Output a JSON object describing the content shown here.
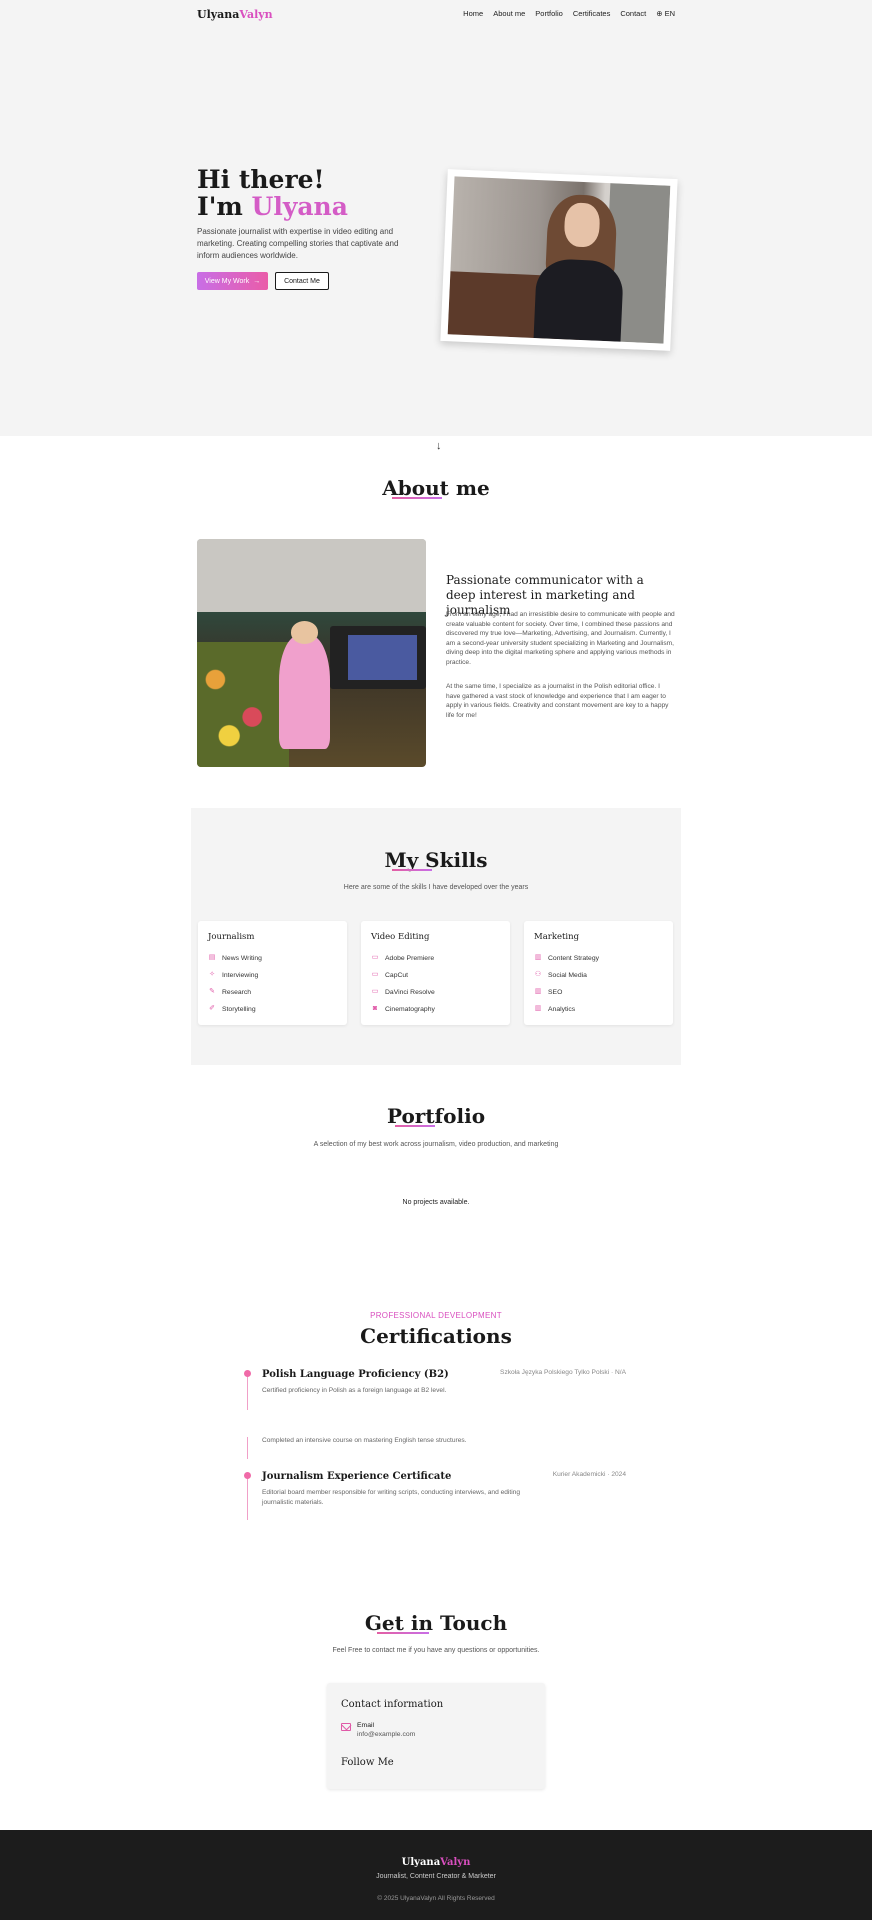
{
  "nav": {
    "logo_first": "Ulyana",
    "logo_second": "Valyn",
    "links": [
      "Home",
      "About me",
      "Portfolio",
      "Certificates",
      "Contact"
    ],
    "language": "EN",
    "language_icon": "globe-icon"
  },
  "hero": {
    "greeting": "Hi there!",
    "im": "I'm",
    "name": "Ulyana",
    "description": "Passionate journalist with expertise in video editing and marketing. Creating compelling stories that captivate and inform audiences worldwide.",
    "primary_button": "View My Work",
    "primary_button_icon": "arrow-right-icon",
    "secondary_button": "Contact Me",
    "scroll_icon": "arrow-down-icon"
  },
  "about": {
    "title": "About me",
    "heading": "Passionate communicator with a deep interest in marketing and journalism",
    "paragraph1": "From an early age, I had an irresistible desire to communicate with people and create valuable content for society. Over time, I combined these passions and discovered my true love—Marketing, Advertising, and Journalism. Currently, I am a second-year university student specializing in Marketing and Journalism, diving deep into the digital marketing sphere and applying various methods in practice.",
    "paragraph2": "At the same time, I specialize as a journalist in the Polish editorial office. I have gathered a vast stock of knowledge and experience that I am eager to apply in various fields. Creativity and constant movement are key to a happy life for me!"
  },
  "skills": {
    "title": "My Skills",
    "subtitle": "Here are some of the skills I have developed over the years",
    "categories": [
      {
        "name": "Journalism",
        "items": [
          {
            "label": "News Writing",
            "icon": "newspaper-icon"
          },
          {
            "label": "Interviewing",
            "icon": "sparkle-icon"
          },
          {
            "label": "Research",
            "icon": "pen-icon"
          },
          {
            "label": "Storytelling",
            "icon": "pencil-icon"
          }
        ]
      },
      {
        "name": "Video Editing",
        "items": [
          {
            "label": "Adobe Premiere",
            "icon": "video-icon"
          },
          {
            "label": "CapCut",
            "icon": "video-icon"
          },
          {
            "label": "DaVinci Resolve",
            "icon": "video-icon"
          },
          {
            "label": "Cinematography",
            "icon": "camera-icon"
          }
        ]
      },
      {
        "name": "Marketing",
        "items": [
          {
            "label": "Content Strategy",
            "icon": "bar-chart-icon"
          },
          {
            "label": "Social Media",
            "icon": "users-icon"
          },
          {
            "label": "SEO",
            "icon": "bar-chart-icon"
          },
          {
            "label": "Analytics",
            "icon": "bar-chart-icon"
          }
        ]
      }
    ]
  },
  "portfolio": {
    "title": "Portfolio",
    "subtitle": "A selection of my best work across journalism, video production, and marketing",
    "empty": "No projects available."
  },
  "certifications": {
    "kicker": "PROFESSIONAL DEVELOPMENT",
    "title": "Certifications",
    "items": [
      {
        "title": "Polish Language Proficiency (B2)",
        "desc": "Certified proficiency in Polish as a foreign language at B2 level.",
        "meta": "Szkoła Języka Polskiego Tylko Polski · N/A"
      },
      {
        "title": "",
        "desc": "Completed an intensive course on mastering English tense structures.",
        "meta": ""
      },
      {
        "title": "Journalism Experience Certificate",
        "desc": "Editorial board member responsible for writing scripts, conducting interviews, and editing journalistic materials.",
        "meta": "Kurier Akademicki · 2024"
      }
    ]
  },
  "contact": {
    "title": "Get in Touch",
    "subtitle": "Feel Free to contact me if you have any questions or opportunities.",
    "card_title": "Contact information",
    "email_label": "Email",
    "email_value": "info@example.com",
    "email_icon": "mail-icon",
    "follow_title": "Follow Me"
  },
  "footer": {
    "logo_first": "Ulyana",
    "logo_second": "Valyn",
    "tagline": "Journalist, Content Creator & Marketer",
    "copyright": "© 2025 UlyanaValyn All Rights Reserved"
  },
  "colors": {
    "accent_pink": "#d94fbf",
    "accent_purple": "#c86ee6",
    "background_gray": "#f4f4f4",
    "footer_dark": "#1c1c1c"
  }
}
